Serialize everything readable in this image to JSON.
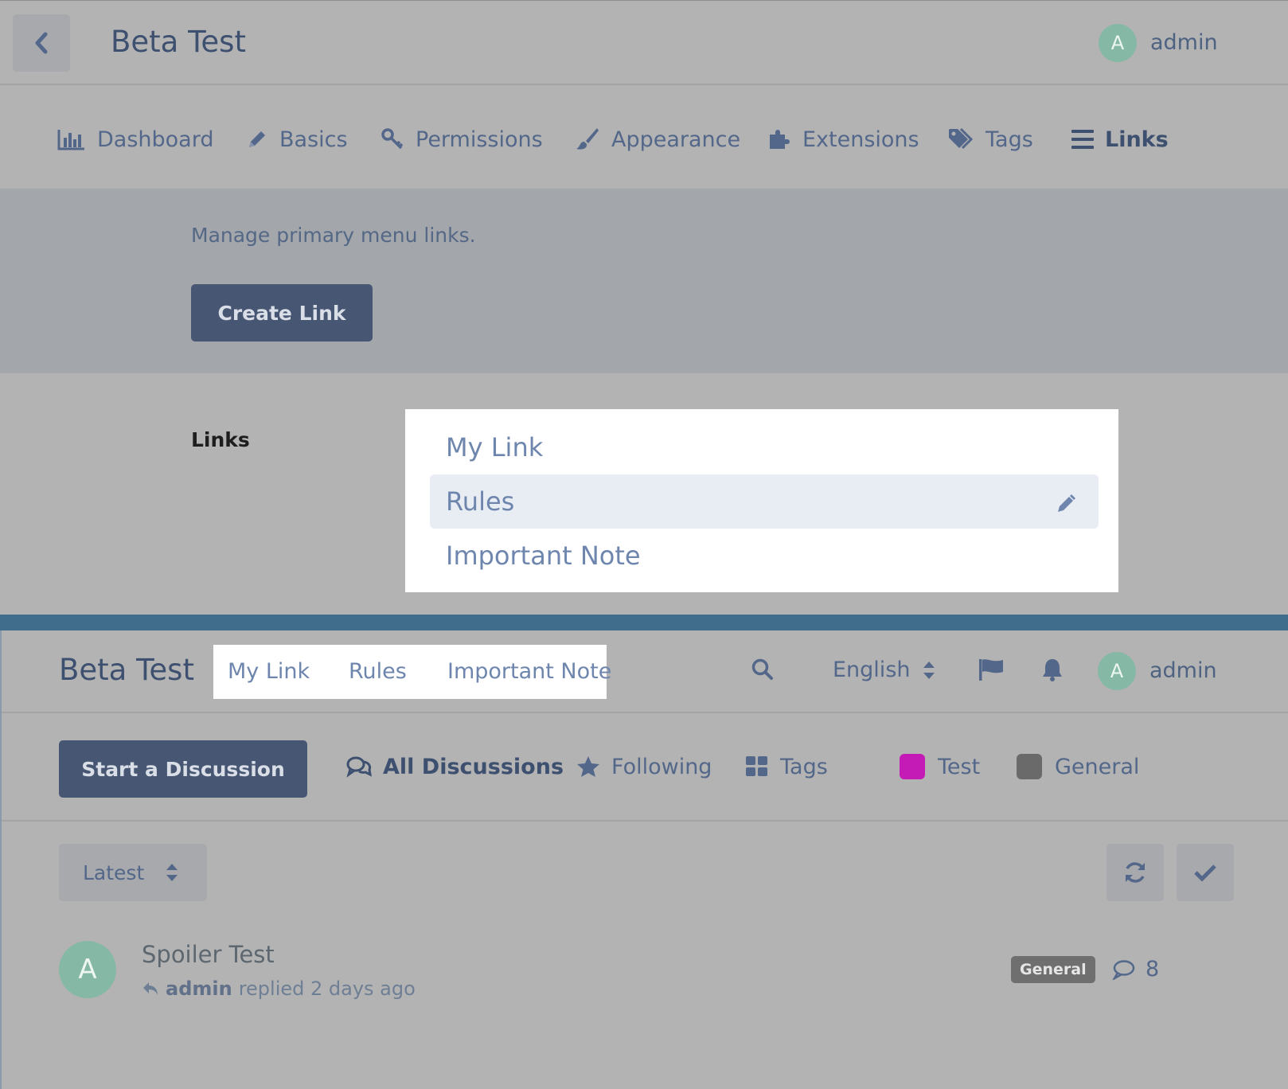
{
  "admin": {
    "title": "Beta Test",
    "user": {
      "name": "admin",
      "initial": "A"
    },
    "nav": [
      {
        "label": "Dashboard",
        "icon": "bar-chart-icon"
      },
      {
        "label": "Basics",
        "icon": "pencil-icon"
      },
      {
        "label": "Permissions",
        "icon": "key-icon"
      },
      {
        "label": "Appearance",
        "icon": "paintbrush-icon"
      },
      {
        "label": "Extensions",
        "icon": "puzzle-icon"
      },
      {
        "label": "Tags",
        "icon": "tags-icon"
      },
      {
        "label": "Links",
        "icon": "bars-icon",
        "active": true
      }
    ],
    "intro": "Manage primary menu links.",
    "create_button": "Create Link",
    "links_label": "Links",
    "links": [
      {
        "label": "My Link"
      },
      {
        "label": "Rules",
        "selected": true
      },
      {
        "label": "Important Note"
      }
    ]
  },
  "forum": {
    "title": "Beta Test",
    "primary_links": [
      "My Link",
      "Rules",
      "Important Note"
    ],
    "language": "English",
    "user": {
      "name": "admin",
      "initial": "A"
    },
    "start_button": "Start a Discussion",
    "nav": [
      {
        "label": "All Discussions",
        "icon": "comments-icon",
        "active": true
      },
      {
        "label": "Following",
        "icon": "star-icon"
      },
      {
        "label": "Tags",
        "icon": "grid-icon"
      },
      {
        "label": "Test",
        "color": "#c41bb6"
      },
      {
        "label": "General",
        "color": "#6a6a6a"
      }
    ],
    "sort": "Latest",
    "discussion": {
      "author_initial": "A",
      "title": "Spoiler Test",
      "replier": "admin",
      "time": "replied 2 days ago",
      "tag": "General",
      "replies": "8"
    }
  }
}
